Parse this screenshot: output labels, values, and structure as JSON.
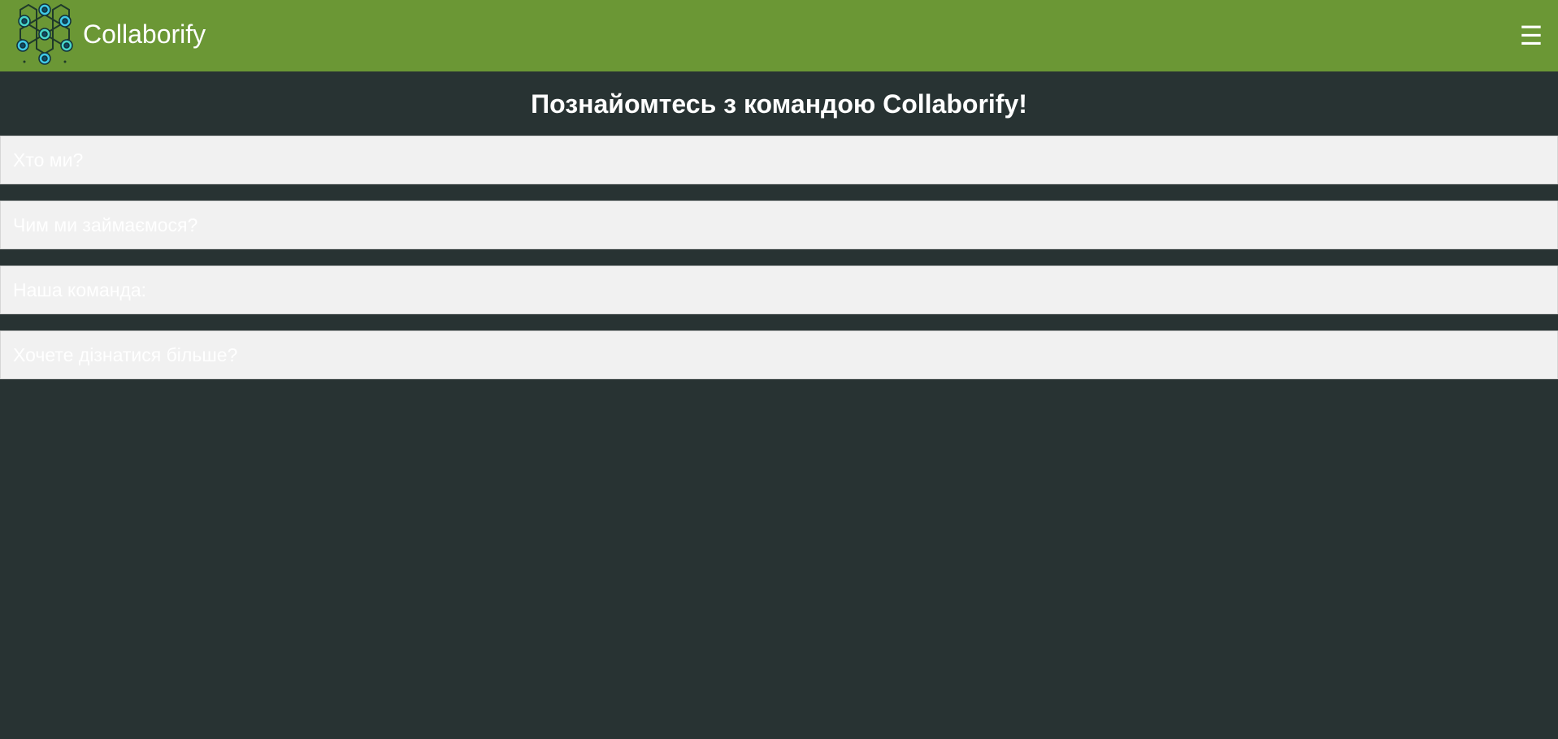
{
  "header": {
    "brand": "Collaborify",
    "menu_icon": "☰",
    "logo_icon": "hexagon-network-logo"
  },
  "main": {
    "title": "Познайомтесь з командою Collaborify!",
    "sections": [
      {
        "label": "Хто ми?"
      },
      {
        "label": "Чим ми займаємося?"
      },
      {
        "label": "Наша команда:"
      },
      {
        "label": "Хочете дізнатися більше?"
      }
    ]
  },
  "colors": {
    "header_bg": "#6b9735",
    "page_bg": "#283333",
    "accordion_bg": "#f1f1f1"
  }
}
